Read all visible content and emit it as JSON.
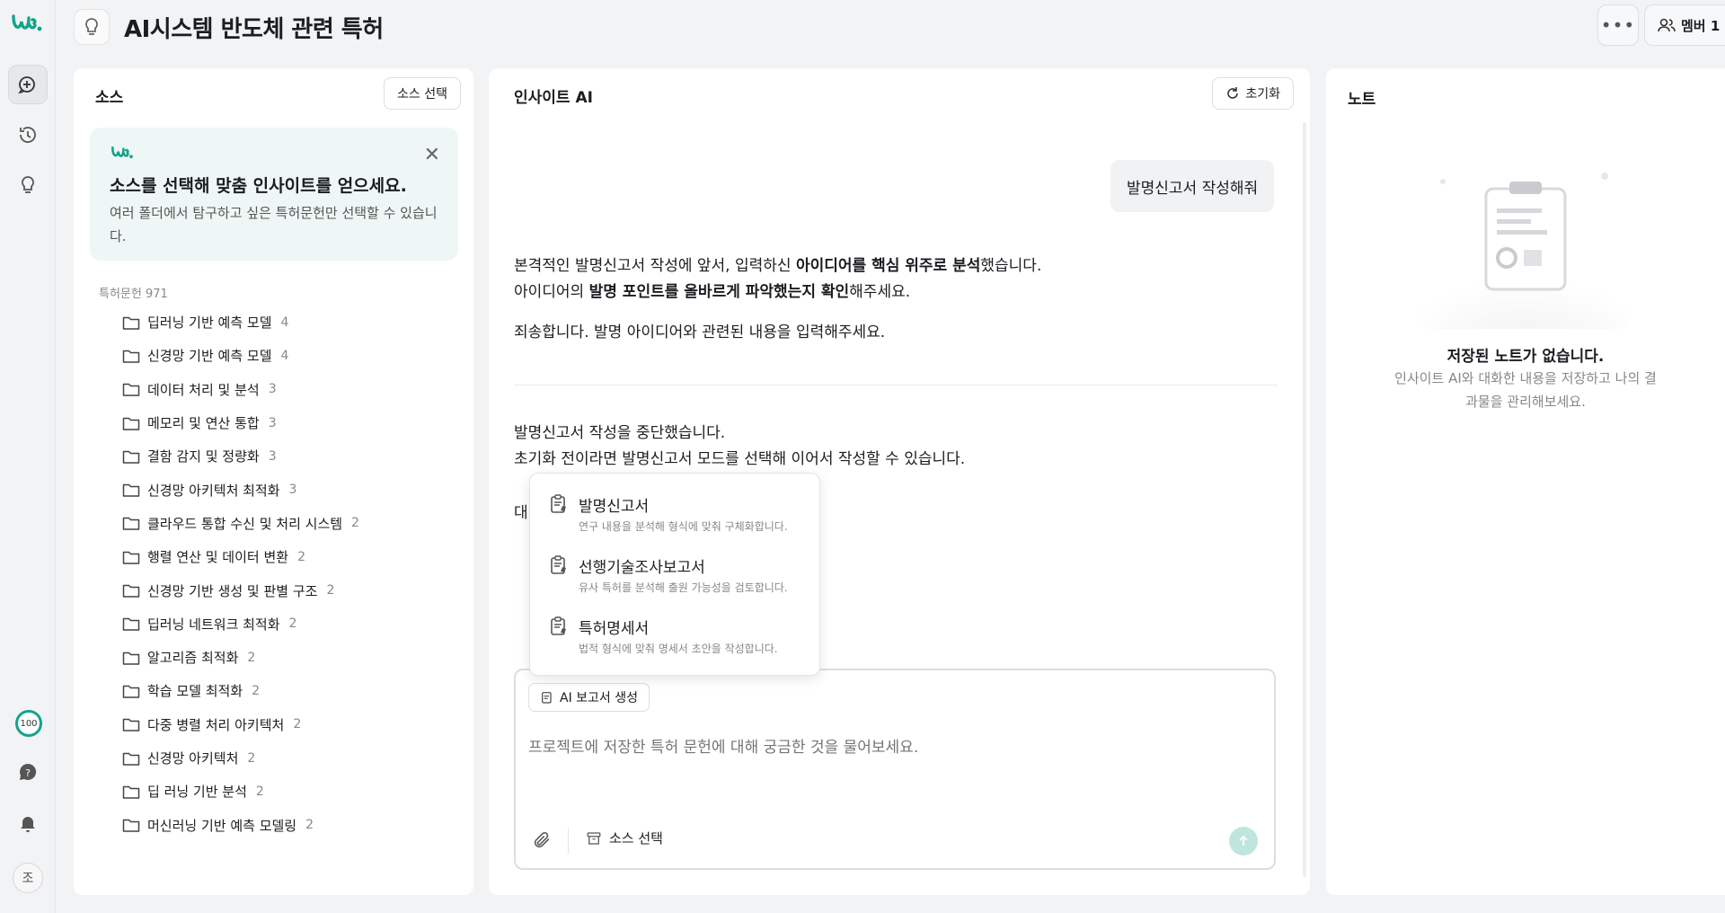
{
  "header": {
    "title": "AI시스템 반도체 관련 특허",
    "member_label": "멤버 1"
  },
  "rail": {
    "credit": "100",
    "avatar": "조"
  },
  "source": {
    "title": "소스",
    "select_button": "소스 선택",
    "tip_title": "소스를 선택해 맞춤 인사이트를 얻으세요.",
    "tip_desc": "여러 폴더에서 탐구하고 싶은 특허문헌만 선택할 수 있습니다.",
    "count_label": "특허문헌 971",
    "folders": [
      {
        "name": "딥러닝 기반 예측 모델",
        "count": "4"
      },
      {
        "name": "신경망 기반 예측 모델",
        "count": "4"
      },
      {
        "name": "데이터 처리 및 분석",
        "count": "3"
      },
      {
        "name": "메모리 및 연산 통합",
        "count": "3"
      },
      {
        "name": "결함 감지 및 정량화",
        "count": "3"
      },
      {
        "name": "신경망 아키텍처 최적화",
        "count": "3"
      },
      {
        "name": "클라우드 통합 수신 및 처리 시스템",
        "count": "2"
      },
      {
        "name": "행렬 연산 및 데이터 변환",
        "count": "2"
      },
      {
        "name": "신경망 기반 생성 및 판별 구조",
        "count": "2"
      },
      {
        "name": "딥러닝 네트워크 최적화",
        "count": "2"
      },
      {
        "name": "알고리즘 최적화",
        "count": "2"
      },
      {
        "name": "학습 모델 최적화",
        "count": "2"
      },
      {
        "name": "다중 병렬 처리 아키텍처",
        "count": "2"
      },
      {
        "name": "신경망 아키텍처",
        "count": "2"
      },
      {
        "name": "딥 러닝 기반 분석",
        "count": "2"
      },
      {
        "name": "머신러닝 기반 예측 모델링",
        "count": "2"
      }
    ]
  },
  "chat": {
    "title": "인사이트 AI",
    "reset_button": "초기화",
    "user_message": "발명신고서 작성해줘",
    "ai1_line1_pre": "본격적인 발명신고서 작성에 앞서, 입력하신 ",
    "ai1_line1_bold": "아이디어를 핵심 위주로 분석",
    "ai1_line1_post": "했습니다.",
    "ai1_line2_pre": "아이디어의 ",
    "ai1_line2_bold": "발명 포인트를 올바르게 파악했는지 확인",
    "ai1_line2_post": "해주세요.",
    "ai1_line3": "죄송합니다. 발명 아이디어와 관련된 내용을 입력해주세요.",
    "ai2_line1": "발명신고서 작성을 중단했습니다.",
    "ai2_line2": "초기화 전이라면 발명신고서 모드를 선택해 이어서 작성할 수 있습니다.",
    "ai2_line3": "대",
    "popup_items": [
      {
        "title": "발명신고서",
        "desc": "연구 내용을 분석해 형식에 맞춰 구체화합니다."
      },
      {
        "title": "선행기술조사보고서",
        "desc": "유사 특허를 분석해 출원 가능성을 검토합니다."
      },
      {
        "title": "특허명세서",
        "desc": "법적 형식에 맞춰 명세서 초안을 작성합니다."
      }
    ],
    "ai_report_button": "AI 보고서 생성",
    "input_placeholder": "프로젝트에 저장한 특허 문헌에 대해 궁금한 것을 물어보세요.",
    "source_select": "소스 선택"
  },
  "notes": {
    "title": "노트",
    "empty_title": "저장된 노트가 없습니다.",
    "empty_desc": "인사이트 AI와 대화한 내용을 저장하고 나의 결과물을 관리해보세요."
  },
  "colors": {
    "brand": "#14a38b",
    "background": "#f2f3f5",
    "panel": "#ffffff"
  }
}
